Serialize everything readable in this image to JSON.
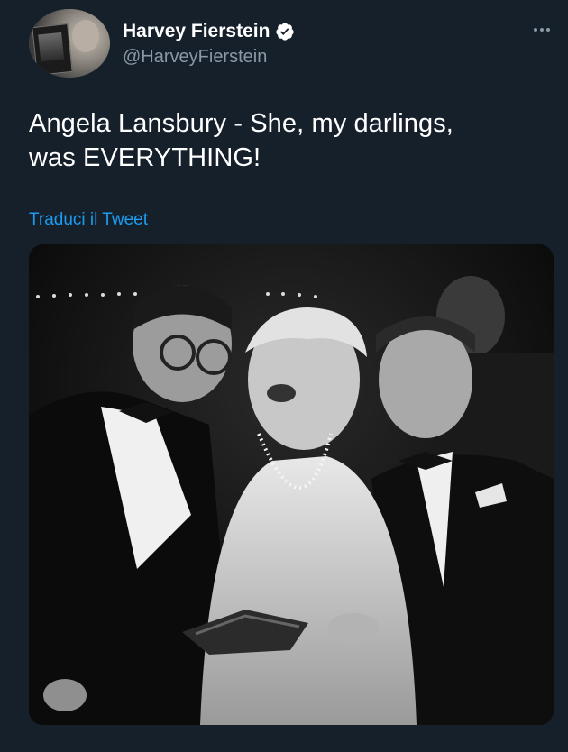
{
  "author": {
    "display_name": "Harvey Fierstein",
    "handle": "@HarveyFierstein",
    "verified": true
  },
  "tweet": {
    "text_line1": "Angela Lansbury - She, my darlings,",
    "text_line2": "was EVERYTHING!",
    "translate_label": "Traduci il Tweet"
  },
  "icons": {
    "verified": "verified-badge-icon",
    "more": "more-options-icon"
  },
  "colors": {
    "background": "#15202b",
    "text_primary": "#ffffff",
    "text_secondary": "#8b98a5",
    "link": "#1d9bf0"
  }
}
